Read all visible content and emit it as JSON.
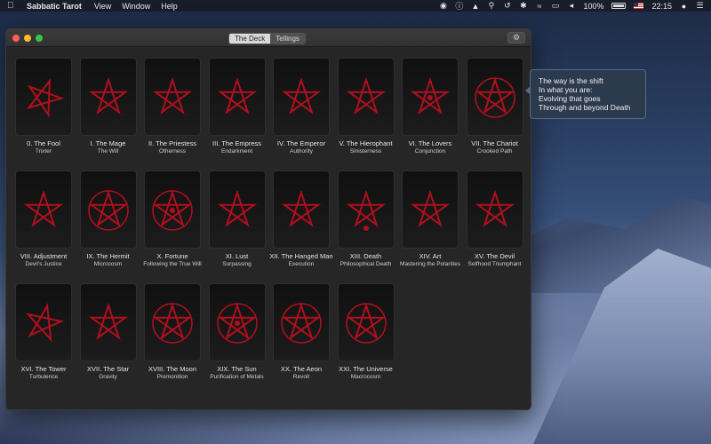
{
  "menubar": {
    "app_name": "Sabbatic Tarot",
    "menus": [
      "View",
      "Window",
      "Help"
    ],
    "battery": "100%",
    "time": "22:15"
  },
  "window": {
    "tabs": [
      {
        "label": "The Deck",
        "active": true
      },
      {
        "label": "Tellings",
        "active": false
      }
    ]
  },
  "accent_color": "#b0101e",
  "cards": [
    {
      "title": "0. The Fool",
      "subtitle": "Trixter"
    },
    {
      "title": "I. The Mage",
      "subtitle": "The Will"
    },
    {
      "title": "II. The Priestess",
      "subtitle": "Otherness"
    },
    {
      "title": "III. The Empress",
      "subtitle": "Endarkment"
    },
    {
      "title": "IV. The Emperor",
      "subtitle": "Authority"
    },
    {
      "title": "V. The Hierophant",
      "subtitle": "Sinisterness"
    },
    {
      "title": "VI. The Lovers",
      "subtitle": "Conjunction"
    },
    {
      "title": "VII. The Chariot",
      "subtitle": "Crooked Path"
    },
    {
      "title": "VIII. Adjustment",
      "subtitle": "Devil's Justice"
    },
    {
      "title": "IX. The Hermit",
      "subtitle": "Microcosm"
    },
    {
      "title": "X. Fortune",
      "subtitle": "Following the True Will"
    },
    {
      "title": "XI. Lust",
      "subtitle": "Surpassing"
    },
    {
      "title": "XII. The Hanged Man",
      "subtitle": "Execution"
    },
    {
      "title": "XIII. Death",
      "subtitle": "Philosophical Death"
    },
    {
      "title": "XIV. Art",
      "subtitle": "Mastering the Polarities"
    },
    {
      "title": "XV. The Devil",
      "subtitle": "Selfhood Triumphant"
    },
    {
      "title": "XVI. The Tower",
      "subtitle": "Turbulence"
    },
    {
      "title": "XVII. The Star",
      "subtitle": "Gravity"
    },
    {
      "title": "XVIII. The Moon",
      "subtitle": "Premonition"
    },
    {
      "title": "XIX. The Sun",
      "subtitle": "Purification of Metals"
    },
    {
      "title": "XX. The Aeon",
      "subtitle": "Revolt"
    },
    {
      "title": "XXI. The Universe",
      "subtitle": "Macrocosm"
    }
  ],
  "popover": {
    "lines": [
      "The way is the shift",
      "In what you are:",
      "Evolving that goes",
      "Through and beyond Death"
    ]
  }
}
